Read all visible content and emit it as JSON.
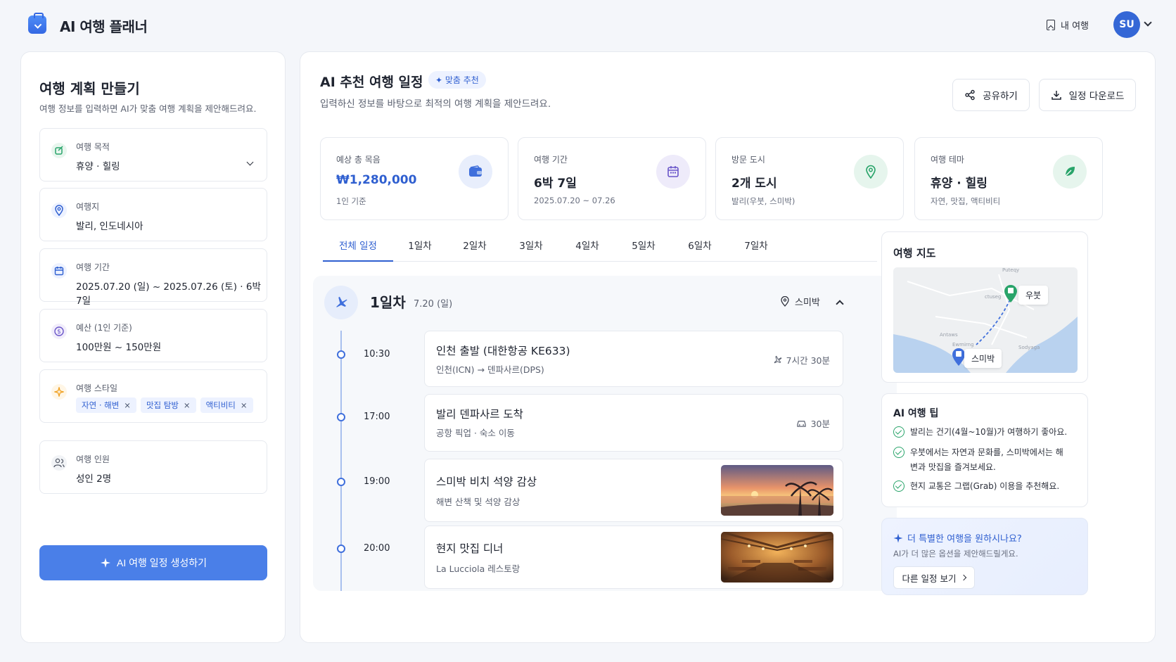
{
  "app": {
    "title": "AI 여행 플래너",
    "my_trip": "내 여행",
    "avatar": "SU"
  },
  "form": {
    "title": "여행 계획 만들기",
    "subtitle": "여행 정보를 입력하면 AI가 맞춤 여행 계획을 제안해드려요.",
    "purpose": {
      "label": "여행 목적",
      "value": "휴양 · 힐링"
    },
    "destination": {
      "label": "여행지",
      "value": "발리, 인도네시아"
    },
    "period": {
      "label": "여행 기간",
      "value": "2025.07.20 (일) ~ 2025.07.26 (토) · 6박 7일"
    },
    "budget": {
      "label": "예산 (1인 기준)",
      "value": "100만원 ~ 150만원"
    },
    "style": {
      "label": "여행 스타일",
      "tags": [
        "자연 · 해변",
        "맛집 탐방",
        "액티비티"
      ]
    },
    "people": {
      "label": "여행 인원",
      "value": "성인 2명"
    },
    "generate": "AI 여행 일정 생성하기"
  },
  "main": {
    "title": "AI 추천 여행 일정",
    "badge": "맞춤 추천",
    "subtitle": "입력하신 정보를 바탕으로 최적의 여행 계획을 제안드려요.",
    "share": "공유하기",
    "download": "일정 다운로드"
  },
  "stats": [
    {
      "label": "예상 총 목음",
      "value": "₩1,280,000",
      "sub": "1인 기준",
      "icon": "wallet-icon",
      "color": "#2f5fd0"
    },
    {
      "label": "여행 기간",
      "value": "6박 7일",
      "sub": "2025.07.20 ~ 07.26",
      "icon": "calendar-icon",
      "color": "#6a56c9"
    },
    {
      "label": "방문 도시",
      "value": "2개 도시",
      "sub": "발리(우붓, 스미박)",
      "icon": "map-pin-icon",
      "color": "#29a46a"
    },
    {
      "label": "여행 테마",
      "value": "휴양 · 힐링",
      "sub": "자연, 맛집, 액티비티",
      "icon": "leaf-icon",
      "color": "#29a46a"
    }
  ],
  "tabs": [
    "전체 일정",
    "1일차",
    "2일차",
    "3일차",
    "4일차",
    "5일차",
    "6일차",
    "7일차"
  ],
  "day": {
    "title": "1일차",
    "date": "7.20 (일)",
    "location": "스미박",
    "events": [
      {
        "time": "10:30",
        "title": "인천 출발 (대한항공 KE633)",
        "sub": "인천(ICN) → 덴파사르(DPS)",
        "meta": "7시간 30분",
        "meta_icon": "plane-icon"
      },
      {
        "time": "17:00",
        "title": "발리 덴파사르 도착",
        "sub": "공항 픽업 · 숙소 이동",
        "meta": "30분",
        "meta_icon": "car-icon"
      },
      {
        "time": "19:00",
        "title": "스미박 비치 석양 감상",
        "sub": "해변 산책 및 석양 감상",
        "photo": "sunset-beach-photo"
      },
      {
        "time": "20:00",
        "title": "현지 맛집 디너",
        "sub": "La Lucciola 레스토랑",
        "photo": "restaurant-photo"
      }
    ]
  },
  "map": {
    "title": "여행 지도",
    "pins": [
      "우붓",
      "스미박"
    ],
    "labels": [
      "Puteqy",
      "ctuseg",
      "Antaws",
      "Sodyaga",
      "Ewmirng"
    ]
  },
  "tips": {
    "title": "AI 여행 팁",
    "items": [
      "발리는 건기(4월~10월)가 여행하기 좋아요.",
      "우붓에서는 자연과 문화를, 스미박에서는 해변과 맛집을 즐겨보세요.",
      "현지 교통은 그랩(Grab) 이용을 추천해요."
    ]
  },
  "promo": {
    "title": "더 특별한 여행을 원하시나요?",
    "sub": "AI가 더 많은 옵션을 제안해드릴게요.",
    "button": "다른 일정 보기"
  }
}
